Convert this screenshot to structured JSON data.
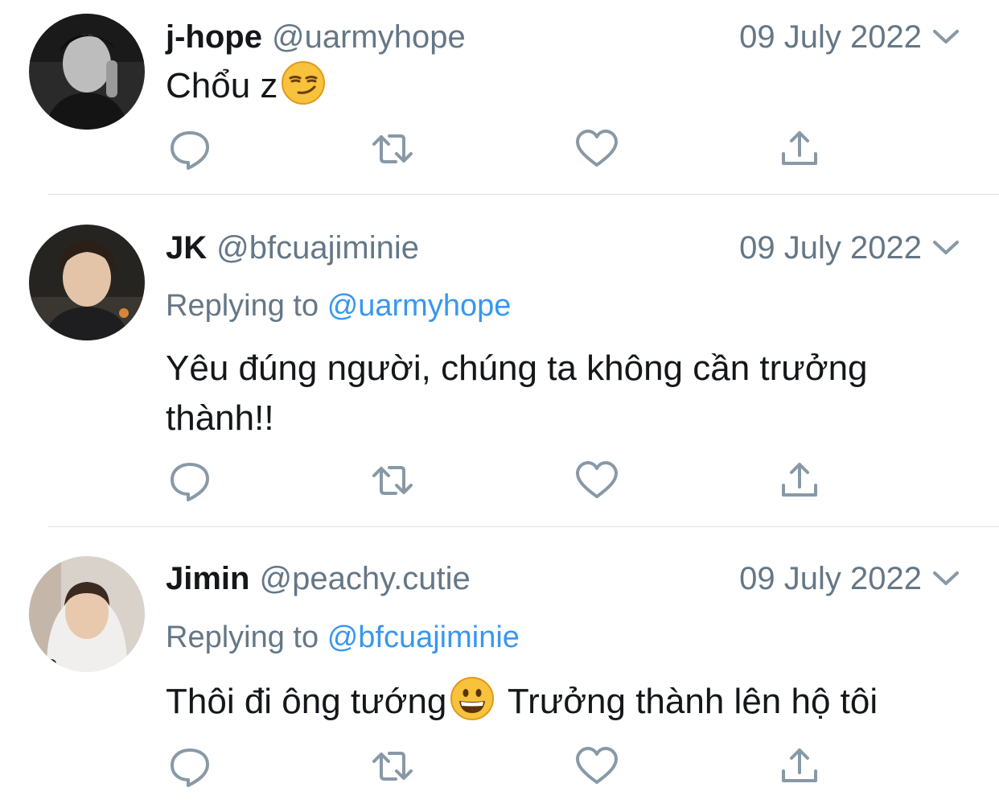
{
  "tweets": [
    {
      "display_name": "j-hope",
      "handle": "@uarmyhope",
      "date": "09 July 2022",
      "replying_label": "",
      "replying_to": "",
      "text_before_emoji": "Chổu z",
      "emoji": "smirking-face",
      "text_after_emoji": ""
    },
    {
      "display_name": "JK",
      "handle": "@bfcuajiminie",
      "date": "09 July 2022",
      "replying_label": "Replying to",
      "replying_to": "@uarmyhope",
      "text": "Yêu đúng người, chúng ta không cần trưởng thành!!"
    },
    {
      "display_name": "Jimin",
      "handle": "@peachy.cutie",
      "date": "09 July 2022",
      "replying_label": "Replying to",
      "replying_to": "@bfcuajiminie",
      "text_before_emoji": "Thôi đi ông tướng",
      "emoji": "grinning-face",
      "text_after_emoji": " Trưởng thành lên hộ tôi"
    }
  ],
  "icons": {
    "reply": "reply-icon",
    "retweet": "retweet-icon",
    "like": "heart-icon",
    "share": "share-icon",
    "caret": "chevron-down-icon"
  },
  "colors": {
    "text": "#14171a",
    "secondary": "#657786",
    "mention": "#3897f0",
    "icon": "#657786",
    "divider": "#dcdfe2"
  }
}
